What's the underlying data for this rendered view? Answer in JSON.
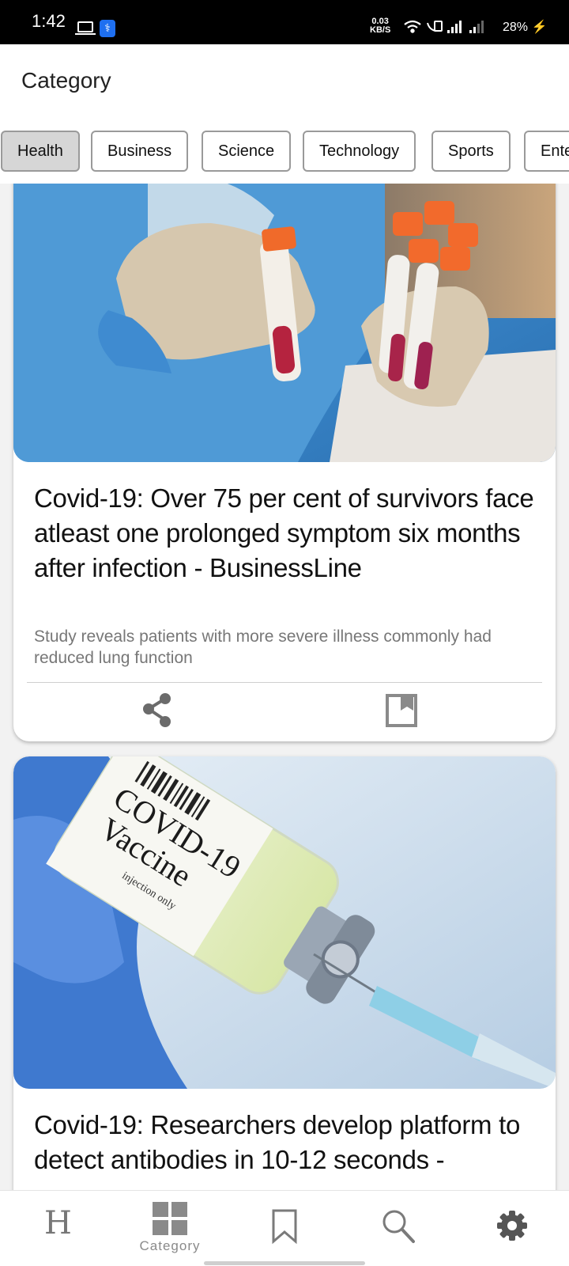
{
  "status_bar": {
    "time": "1:42",
    "net_speed_value": "0.03",
    "net_speed_unit": "KB/S",
    "battery": "28%",
    "icons": [
      "laptop-icon",
      "usb-icon",
      "wifi-icon",
      "volte-icon",
      "signal-icon",
      "signal-icon",
      "charging-icon"
    ]
  },
  "header": {
    "title": "Category"
  },
  "categories": {
    "selected": "Health",
    "items": [
      "Health",
      "Business",
      "Science",
      "Technology",
      "Sports",
      "Entertainment"
    ]
  },
  "articles": [
    {
      "image": "lab-worker-holding-blood-sample-tubes",
      "title": "Covid-19: Over 75 per cent of survivors face atleast one prolonged symptom six months after infection - BusinessLine",
      "description": "Study reveals patients with more severe illness commonly had reduced lung function",
      "actions": [
        "share-icon",
        "bookmark-icon"
      ]
    },
    {
      "image": "covid-19-vaccine-vial-with-syringe",
      "image_text": {
        "line1": "COVID-19",
        "line2": "Vaccine",
        "line3": "injection only"
      },
      "title": "Covid-19: Researchers develop platform to detect antibodies in 10-12 seconds -"
    }
  ],
  "bottom_nav": {
    "items": [
      {
        "icon": "headlines-icon",
        "glyph": "H",
        "label": ""
      },
      {
        "icon": "category-grid-icon",
        "label": "Category",
        "active": true
      },
      {
        "icon": "bookmark-icon",
        "label": ""
      },
      {
        "icon": "search-icon",
        "label": ""
      },
      {
        "icon": "gear-icon",
        "label": ""
      }
    ]
  },
  "colors": {
    "accent_usb": "#1e6ff0",
    "chip_selected": "#d6d6d6",
    "nav_active": "#8a8a8a"
  }
}
